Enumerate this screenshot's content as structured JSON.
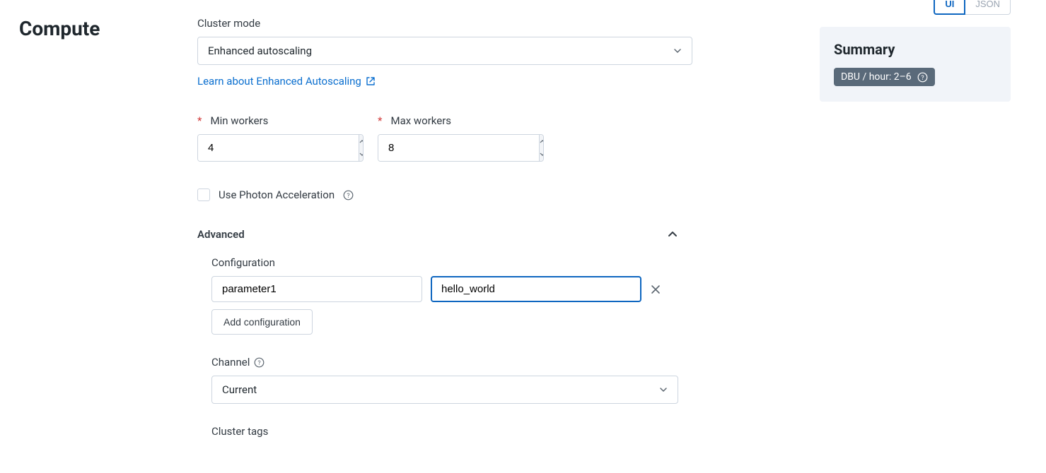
{
  "page_title": "Compute",
  "top_buttons": {
    "ui": "UI",
    "json": "JSON"
  },
  "cluster_mode": {
    "label": "Cluster mode",
    "value": "Enhanced autoscaling",
    "learn_link": "Learn about Enhanced Autoscaling"
  },
  "min_workers": {
    "label": "Min workers",
    "value": "4"
  },
  "max_workers": {
    "label": "Max workers",
    "value": "8"
  },
  "photon": {
    "label": "Use Photon Acceleration"
  },
  "advanced": {
    "title": "Advanced",
    "configuration": {
      "label": "Configuration",
      "key": "parameter1",
      "value": "hello_world",
      "add_button": "Add configuration"
    },
    "channel": {
      "label": "Channel",
      "value": "Current"
    },
    "cluster_tags": {
      "label": "Cluster tags"
    }
  },
  "summary": {
    "title": "Summary",
    "dbu": "DBU / hour: 2–6"
  }
}
